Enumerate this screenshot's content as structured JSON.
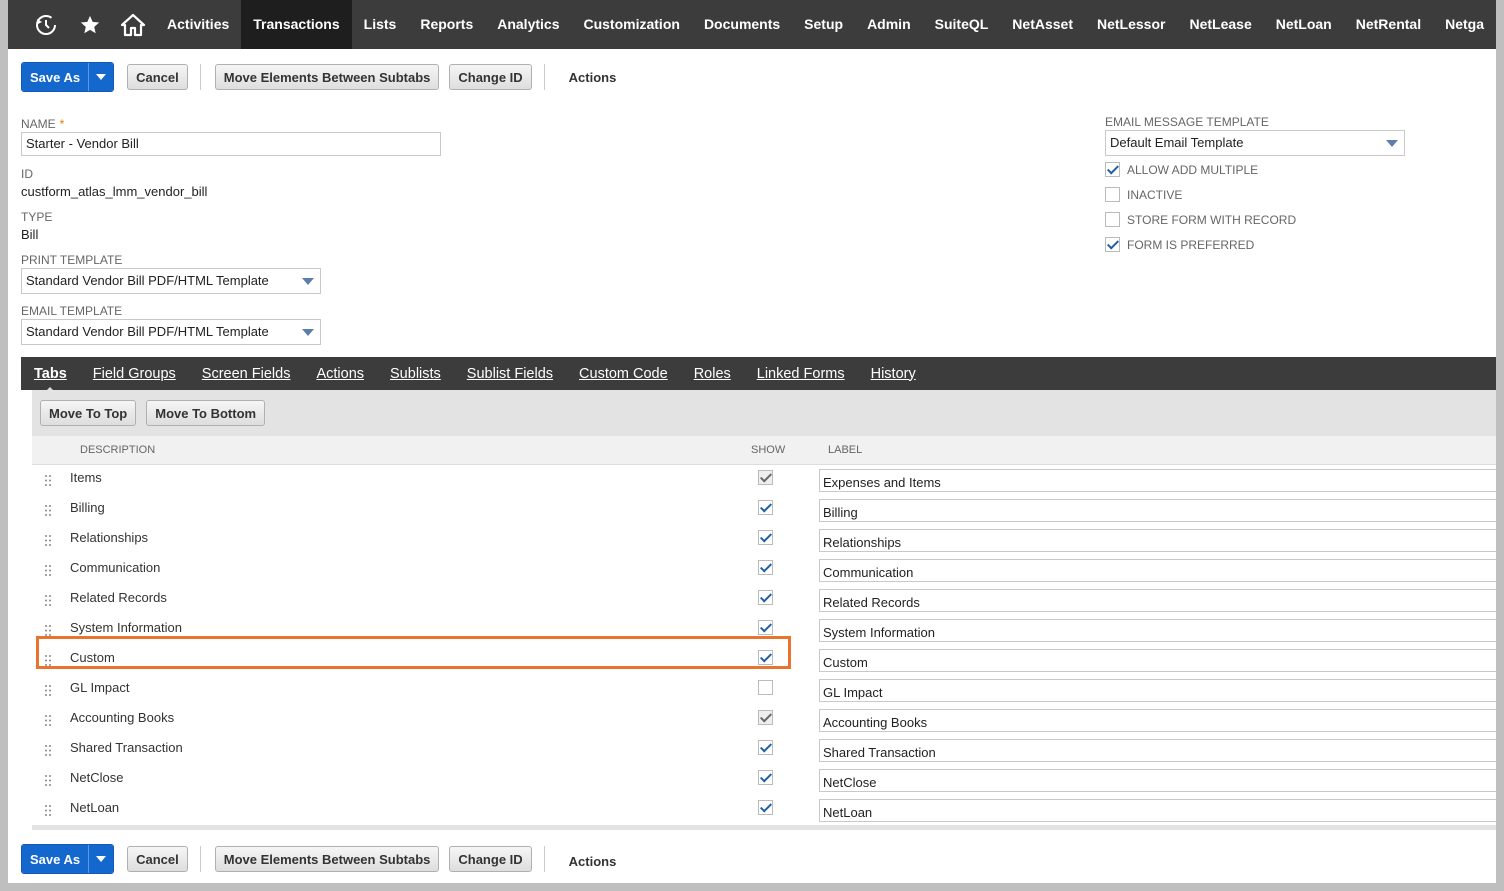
{
  "topnav": {
    "icons": [
      "recent-icon",
      "star-icon",
      "home-icon"
    ],
    "items": [
      "Activities",
      "Transactions",
      "Lists",
      "Reports",
      "Analytics",
      "Customization",
      "Documents",
      "Setup",
      "Admin",
      "SuiteQL",
      "NetAsset",
      "NetLessor",
      "NetLease",
      "NetLoan",
      "NetRental",
      "Netga"
    ],
    "active": "Transactions"
  },
  "toolbar": {
    "save_as": "Save As",
    "cancel": "Cancel",
    "move_elements": "Move Elements Between Subtabs",
    "change_id": "Change ID",
    "actions": "Actions"
  },
  "form": {
    "name_label": "NAME",
    "name_required": "*",
    "name_value": "Starter - Vendor Bill",
    "id_label": "ID",
    "id_value": "custform_atlas_lmm_vendor_bill",
    "type_label": "TYPE",
    "type_value": "Bill",
    "print_template_label": "PRINT TEMPLATE",
    "print_template_value": "Standard Vendor Bill PDF/HTML Template",
    "email_template_label": "EMAIL TEMPLATE",
    "email_template_value": "Standard Vendor Bill PDF/HTML Template",
    "email_message_template_label": "EMAIL MESSAGE TEMPLATE",
    "email_message_template_value": "Default Email Template",
    "checkboxes": [
      {
        "label": "ALLOW ADD MULTIPLE",
        "checked": true
      },
      {
        "label": "INACTIVE",
        "checked": false
      },
      {
        "label": "STORE FORM WITH RECORD",
        "checked": false
      },
      {
        "label": "FORM IS PREFERRED",
        "checked": true
      }
    ]
  },
  "subtabs": {
    "items": [
      "Tabs",
      "Field Groups",
      "Screen Fields",
      "Actions",
      "Sublists",
      "Sublist Fields",
      "Custom Code",
      "Roles",
      "Linked Forms",
      "History"
    ],
    "active": "Tabs"
  },
  "tabs_panel": {
    "move_to_top": "Move To Top",
    "move_to_bottom": "Move To Bottom",
    "columns": {
      "description": "DESCRIPTION",
      "show": "SHOW",
      "label": "LABEL"
    },
    "rows": [
      {
        "description": "Items",
        "show": true,
        "label": "Expenses and Items",
        "locked": true
      },
      {
        "description": "Billing",
        "show": true,
        "label": "Billing",
        "locked": false
      },
      {
        "description": "Relationships",
        "show": true,
        "label": "Relationships",
        "locked": false
      },
      {
        "description": "Communication",
        "show": true,
        "label": "Communication",
        "locked": false
      },
      {
        "description": "Related Records",
        "show": true,
        "label": "Related Records",
        "locked": false
      },
      {
        "description": "System Information",
        "show": true,
        "label": "System Information",
        "locked": false
      },
      {
        "description": "Custom",
        "show": true,
        "label": "Custom",
        "locked": false
      },
      {
        "description": "GL Impact",
        "show": false,
        "label": "GL Impact",
        "locked": false
      },
      {
        "description": "Accounting Books",
        "show": true,
        "label": "Accounting Books",
        "locked": true
      },
      {
        "description": "Shared Transaction",
        "show": true,
        "label": "Shared Transaction",
        "locked": false
      },
      {
        "description": "NetClose",
        "show": true,
        "label": "NetClose",
        "locked": false
      },
      {
        "description": "NetLoan",
        "show": true,
        "label": "NetLoan",
        "locked": false
      }
    ]
  },
  "colors": {
    "nav_bg": "#3c3c3c",
    "primary_button": "#1467cc",
    "highlight_border": "#e8742f"
  }
}
